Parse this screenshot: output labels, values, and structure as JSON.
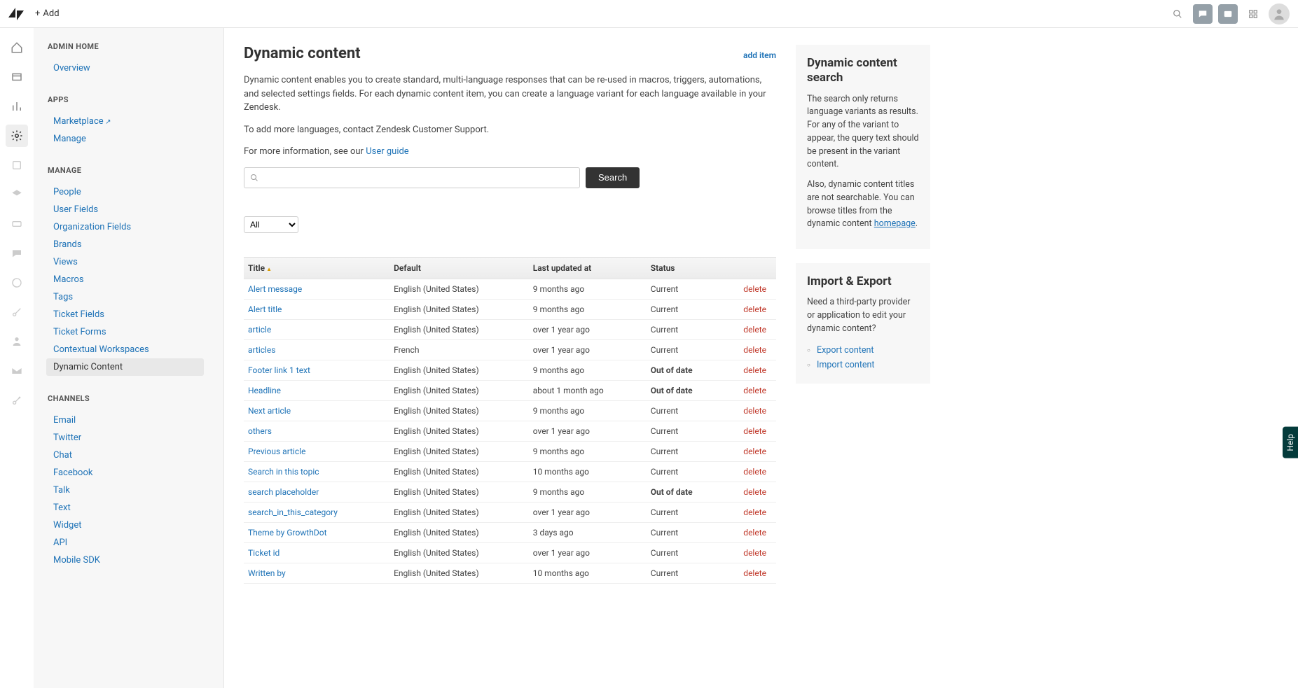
{
  "topbar": {
    "add_label": "Add"
  },
  "sidebar": {
    "sections": [
      {
        "heading": "ADMIN HOME",
        "items": [
          {
            "label": "Overview",
            "current": false
          }
        ]
      },
      {
        "heading": "APPS",
        "items": [
          {
            "label": "Marketplace",
            "ext": true
          },
          {
            "label": "Manage"
          }
        ]
      },
      {
        "heading": "MANAGE",
        "items": [
          {
            "label": "People"
          },
          {
            "label": "User Fields"
          },
          {
            "label": "Organization Fields"
          },
          {
            "label": "Brands"
          },
          {
            "label": "Views"
          },
          {
            "label": "Macros"
          },
          {
            "label": "Tags"
          },
          {
            "label": "Ticket Fields"
          },
          {
            "label": "Ticket Forms"
          },
          {
            "label": "Contextual Workspaces"
          },
          {
            "label": "Dynamic Content",
            "current": true
          }
        ]
      },
      {
        "heading": "CHANNELS",
        "items": [
          {
            "label": "Email"
          },
          {
            "label": "Twitter"
          },
          {
            "label": "Chat"
          },
          {
            "label": "Facebook"
          },
          {
            "label": "Talk"
          },
          {
            "label": "Text"
          },
          {
            "label": "Widget"
          },
          {
            "label": "API"
          },
          {
            "label": "Mobile SDK"
          }
        ]
      }
    ]
  },
  "page": {
    "title": "Dynamic content",
    "add_item": "add item",
    "intro1": "Dynamic content enables you to create standard, multi-language responses that can be re-used in macros, triggers, automations, and selected settings fields. For each dynamic content item, you can create a language variant for each language available in your Zendesk.",
    "intro2": "To add more languages, contact Zendesk Customer Support.",
    "intro3_pre": "For more information, see our ",
    "intro3_link": "User guide",
    "search_button": "Search",
    "filter_value": "All",
    "table": {
      "cols": [
        "Title",
        "Default",
        "Last updated at",
        "Status"
      ],
      "delete_label": "delete",
      "rows": [
        {
          "title": "Alert message",
          "default": "English (United States)",
          "updated": "9 months ago",
          "status": "Current"
        },
        {
          "title": "Alert title",
          "default": "English (United States)",
          "updated": "9 months ago",
          "status": "Current"
        },
        {
          "title": "article",
          "default": "English (United States)",
          "updated": "over 1 year ago",
          "status": "Current"
        },
        {
          "title": "articles",
          "default": "French",
          "updated": "over 1 year ago",
          "status": "Current"
        },
        {
          "title": "Footer link 1 text",
          "default": "English (United States)",
          "updated": "9 months ago",
          "status": "Out of date"
        },
        {
          "title": "Headline",
          "default": "English (United States)",
          "updated": "about 1 month ago",
          "status": "Out of date"
        },
        {
          "title": "Next article",
          "default": "English (United States)",
          "updated": "9 months ago",
          "status": "Current"
        },
        {
          "title": "others",
          "default": "English (United States)",
          "updated": "over 1 year ago",
          "status": "Current"
        },
        {
          "title": "Previous article",
          "default": "English (United States)",
          "updated": "9 months ago",
          "status": "Current"
        },
        {
          "title": "Search in this topic",
          "default": "English (United States)",
          "updated": "10 months ago",
          "status": "Current"
        },
        {
          "title": "search placeholder",
          "default": "English (United States)",
          "updated": "9 months ago",
          "status": "Out of date"
        },
        {
          "title": "search_in_this_category",
          "default": "English (United States)",
          "updated": "over 1 year ago",
          "status": "Current"
        },
        {
          "title": "Theme by GrowthDot",
          "default": "English (United States)",
          "updated": "3 days ago",
          "status": "Current"
        },
        {
          "title": "Ticket id",
          "default": "English (United States)",
          "updated": "over 1 year ago",
          "status": "Current"
        },
        {
          "title": "Written by",
          "default": "English (United States)",
          "updated": "10 months ago",
          "status": "Current"
        }
      ]
    }
  },
  "aside": {
    "search_panel": {
      "title": "Dynamic content search",
      "p1": "The search only returns language variants as results. For any of the variant to appear, the query text should be present in the variant content.",
      "p2_pre": "Also, dynamic content titles are not searchable. You can browse titles from the dynamic content ",
      "p2_link": "homepage",
      "p2_post": "."
    },
    "export_panel": {
      "title": "Import & Export",
      "p1": "Need a third-party provider or application to edit your dynamic content?",
      "links": [
        "Export content",
        "Import content"
      ]
    }
  },
  "help_tab": "Help"
}
